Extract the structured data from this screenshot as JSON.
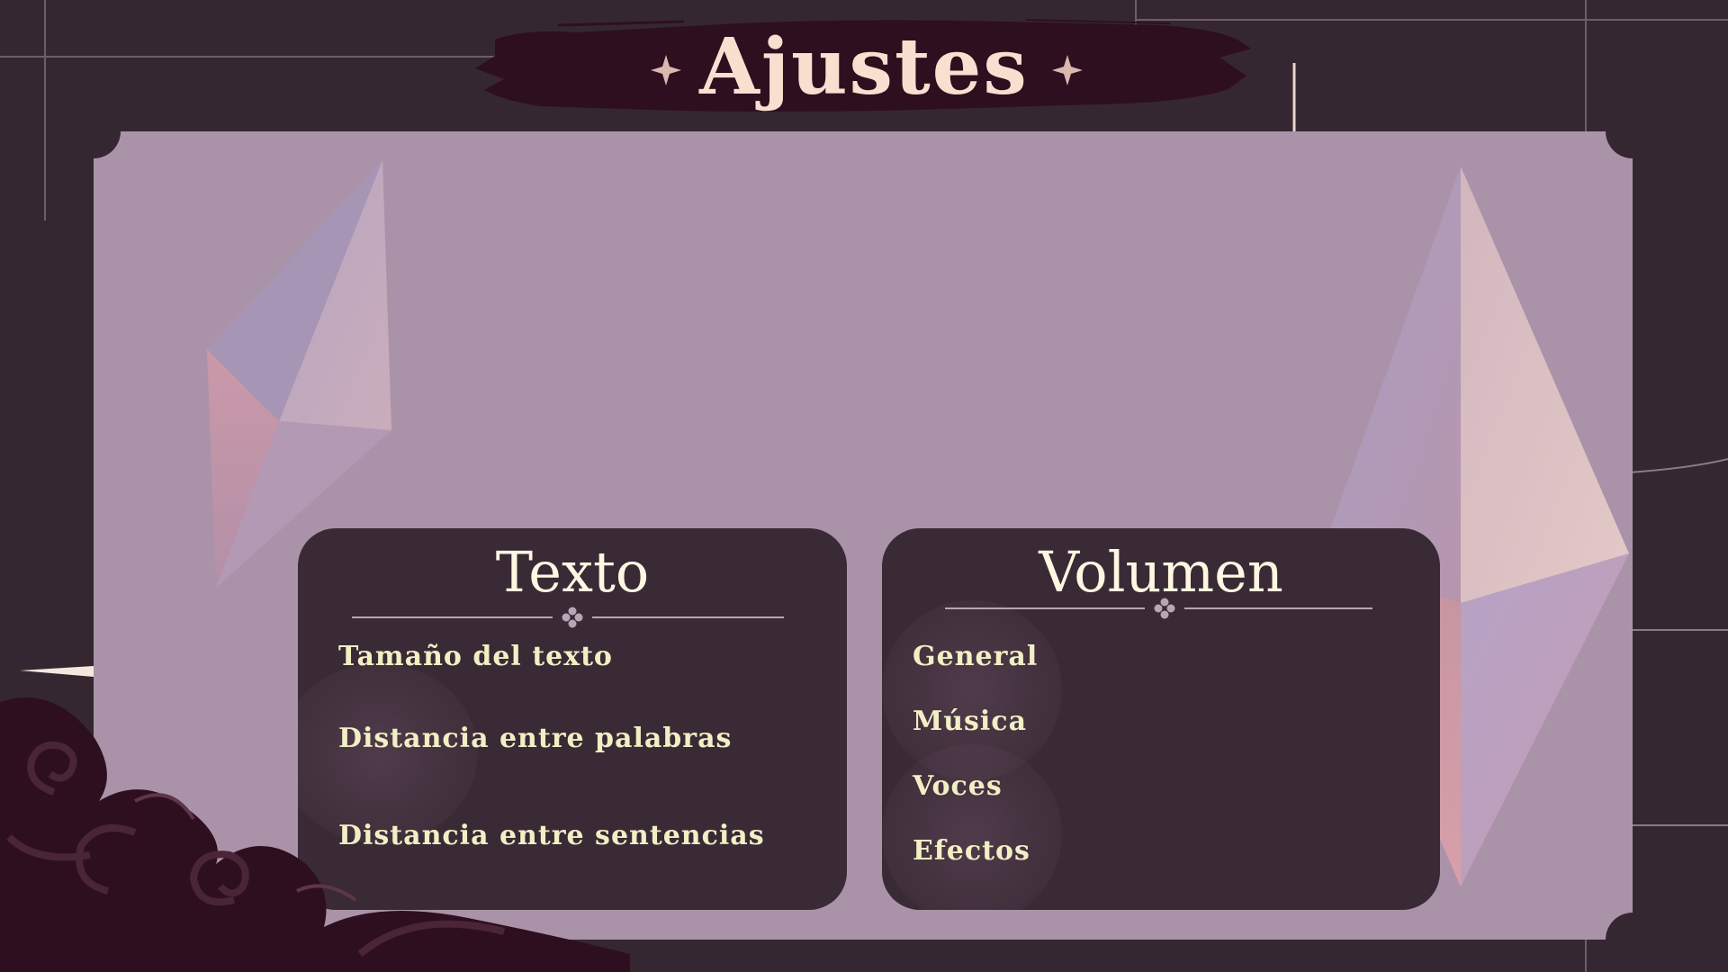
{
  "header": {
    "title": "Ajustes"
  },
  "texto_panel": {
    "title": "Texto",
    "items": [
      {
        "label": "Tamaño del texto"
      },
      {
        "label": "Distancia entre palabras"
      },
      {
        "label": "Distancia entre sentencias"
      }
    ]
  },
  "volumen_panel": {
    "title": "Volumen",
    "items": [
      {
        "label": "General"
      },
      {
        "label": "Música"
      },
      {
        "label": "Voces"
      },
      {
        "label": "Efectos"
      }
    ]
  },
  "colors": {
    "background": "#352731",
    "panel": "#aa93a8",
    "card": "#3a2a36",
    "title_banner": "#2e0f1f",
    "title_text": "#f9dfd0",
    "label_text": "#f1efc4"
  }
}
